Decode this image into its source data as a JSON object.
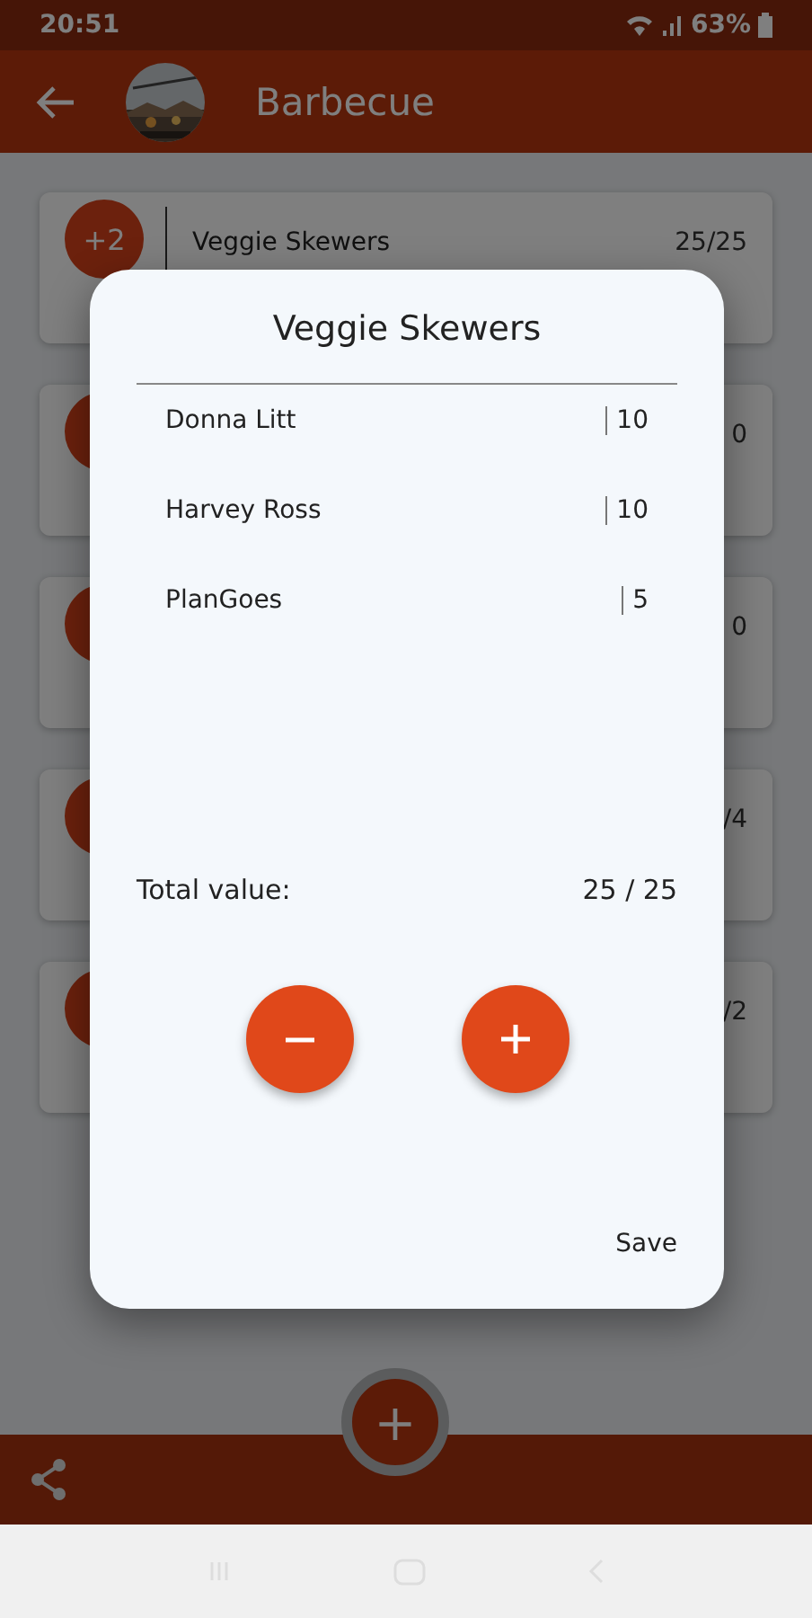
{
  "status_bar": {
    "time": "20:51",
    "battery": "63%"
  },
  "app_bar": {
    "title": "Barbecue"
  },
  "cards": [
    {
      "badge": "+2",
      "name": "Veggie Skewers",
      "value": "25/25"
    },
    {
      "value": "0"
    },
    {
      "value": "0"
    },
    {
      "value": "/4"
    },
    {
      "value": "/2"
    }
  ],
  "dialog": {
    "title": "Veggie Skewers",
    "rows": [
      {
        "name": "Donna Litt",
        "value": "10"
      },
      {
        "name": "Harvey Ross",
        "value": "10"
      },
      {
        "name": "PlanGoes",
        "value": "5"
      }
    ],
    "total_label": "Total value:",
    "total_value": "25 / 25",
    "buttons": [
      {
        "kind": "decrement"
      },
      {
        "kind": "increment"
      }
    ],
    "save": "Save"
  },
  "fab": {
    "label": "+"
  }
}
